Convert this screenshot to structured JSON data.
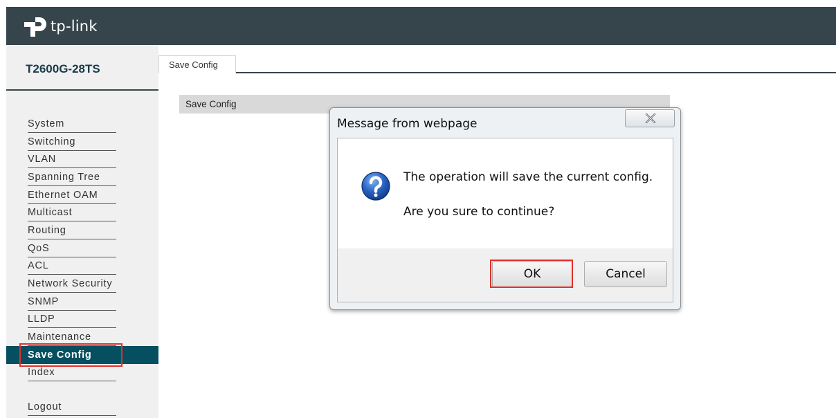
{
  "header": {
    "brand": "tp-link"
  },
  "sidebar": {
    "model": "T2600G-28TS",
    "items": [
      {
        "label": "System"
      },
      {
        "label": "Switching"
      },
      {
        "label": "VLAN"
      },
      {
        "label": "Spanning Tree"
      },
      {
        "label": "Ethernet OAM"
      },
      {
        "label": "Multicast"
      },
      {
        "label": "Routing"
      },
      {
        "label": "QoS"
      },
      {
        "label": "ACL"
      },
      {
        "label": "Network Security"
      },
      {
        "label": "SNMP"
      },
      {
        "label": "LLDP"
      },
      {
        "label": "Maintenance"
      },
      {
        "label": "Save Config",
        "active": true
      },
      {
        "label": "Index"
      }
    ],
    "logout": "Logout"
  },
  "tab": {
    "label": "Save Config"
  },
  "section": {
    "title": "Save Config"
  },
  "dialog": {
    "title": "Message from webpage",
    "line1": "The operation will save the current config.",
    "line2": "Are you sure to continue?",
    "ok_label": "OK",
    "cancel_label": "Cancel"
  },
  "colors": {
    "header_bg": "#36454b",
    "active_nav": "#054f60",
    "highlight": "#e0302a"
  }
}
